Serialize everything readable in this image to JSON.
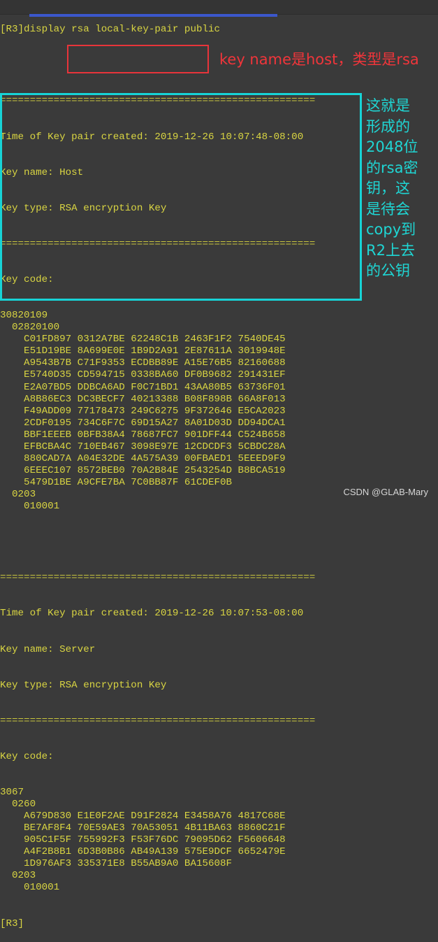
{
  "terminal": {
    "command": "[R3]display rsa local-key-pair public",
    "separator": "=====================================================",
    "key_pairs": [
      {
        "time_label": "Time of Key pair created: 2019-12-26 10:07:48-08:00",
        "name_label": "Key name: Host",
        "type_label": "Key type: RSA encryption Key",
        "code_label": "Key code:",
        "code_lines": [
          "30820109",
          "  02820100",
          "    C01FD897 0312A7BE 62248C1B 2463F1F2 7540DE45",
          "    E51D19BE 8A699E0E 1B9D2A91 2E87611A 3019948E",
          "    A9543B7B C71F9353 ECDBB89E A15E76B5 82160688",
          "    E5740D35 CD594715 0338BA60 DF0B9682 291431EF",
          "    E2A07BD5 DDBCA6AD F0C71BD1 43AA80B5 63736F01",
          "    A8B86EC3 DC3BECF7 40213388 B08F898B 66A8F013",
          "    F49ADD09 77178473 249C6275 9F372646 E5CA2023",
          "    2CDF0195 734C6F7C 69D15A27 8A01D03D DD94DCA1",
          "    BBF1EEEB 0BFB38A4 78687FC7 901DFF44 C524B658",
          "    EFBCBA4C 710EB467 3098E97E 12CDCDF3 5CBDC28A",
          "    880CAD7A A04E32DE 4A575A39 00FBAED1 5EEED9F9",
          "    6EEEC107 8572BEB0 70A2B84E 2543254D B8BCA519",
          "    5479D1BE A9CFE7BA 7C0BB87F 61CDEF0B",
          "  0203",
          "    010001"
        ]
      },
      {
        "time_label": "Time of Key pair created: 2019-12-26 10:07:53-08:00",
        "name_label": "Key name: Server",
        "type_label": "Key type: RSA encryption Key",
        "code_label": "Key code:",
        "code_lines": [
          "3067",
          "  0260",
          "    A679D830 E1E0F2AE D91F2824 E3458A76 4817C68E",
          "    BE7AF8F4 70E59AE3 70A53051 4B11BA63 8860C21F",
          "    905C1F5F 755992F3 F53F76DC 79095D62 F5606648",
          "    A4F2B8B1 6D3B0B86 AB49A139 575E9DCF 6652479E",
          "    1D976AF3 335371E8 B55AB9A0 BA15608F",
          "  0203",
          "    010001"
        ]
      }
    ],
    "prompt": "[R3]"
  },
  "annotations": {
    "red_note": "key name是host，类型是rsa",
    "cyan_note_lines": [
      "这就是",
      "形成的",
      "2048位",
      "的rsa密",
      "钥，这",
      "是待会",
      "copy到",
      "R2上去",
      "的公钥"
    ]
  },
  "watermark": "CSDN @GLAB-Mary",
  "colors": {
    "background": "#3a3a3a",
    "terminal_text": "#d9d542",
    "underline_blue": "#3b57cc",
    "highlight_red": "#e8343a",
    "highlight_cyan": "#17d3d6"
  }
}
